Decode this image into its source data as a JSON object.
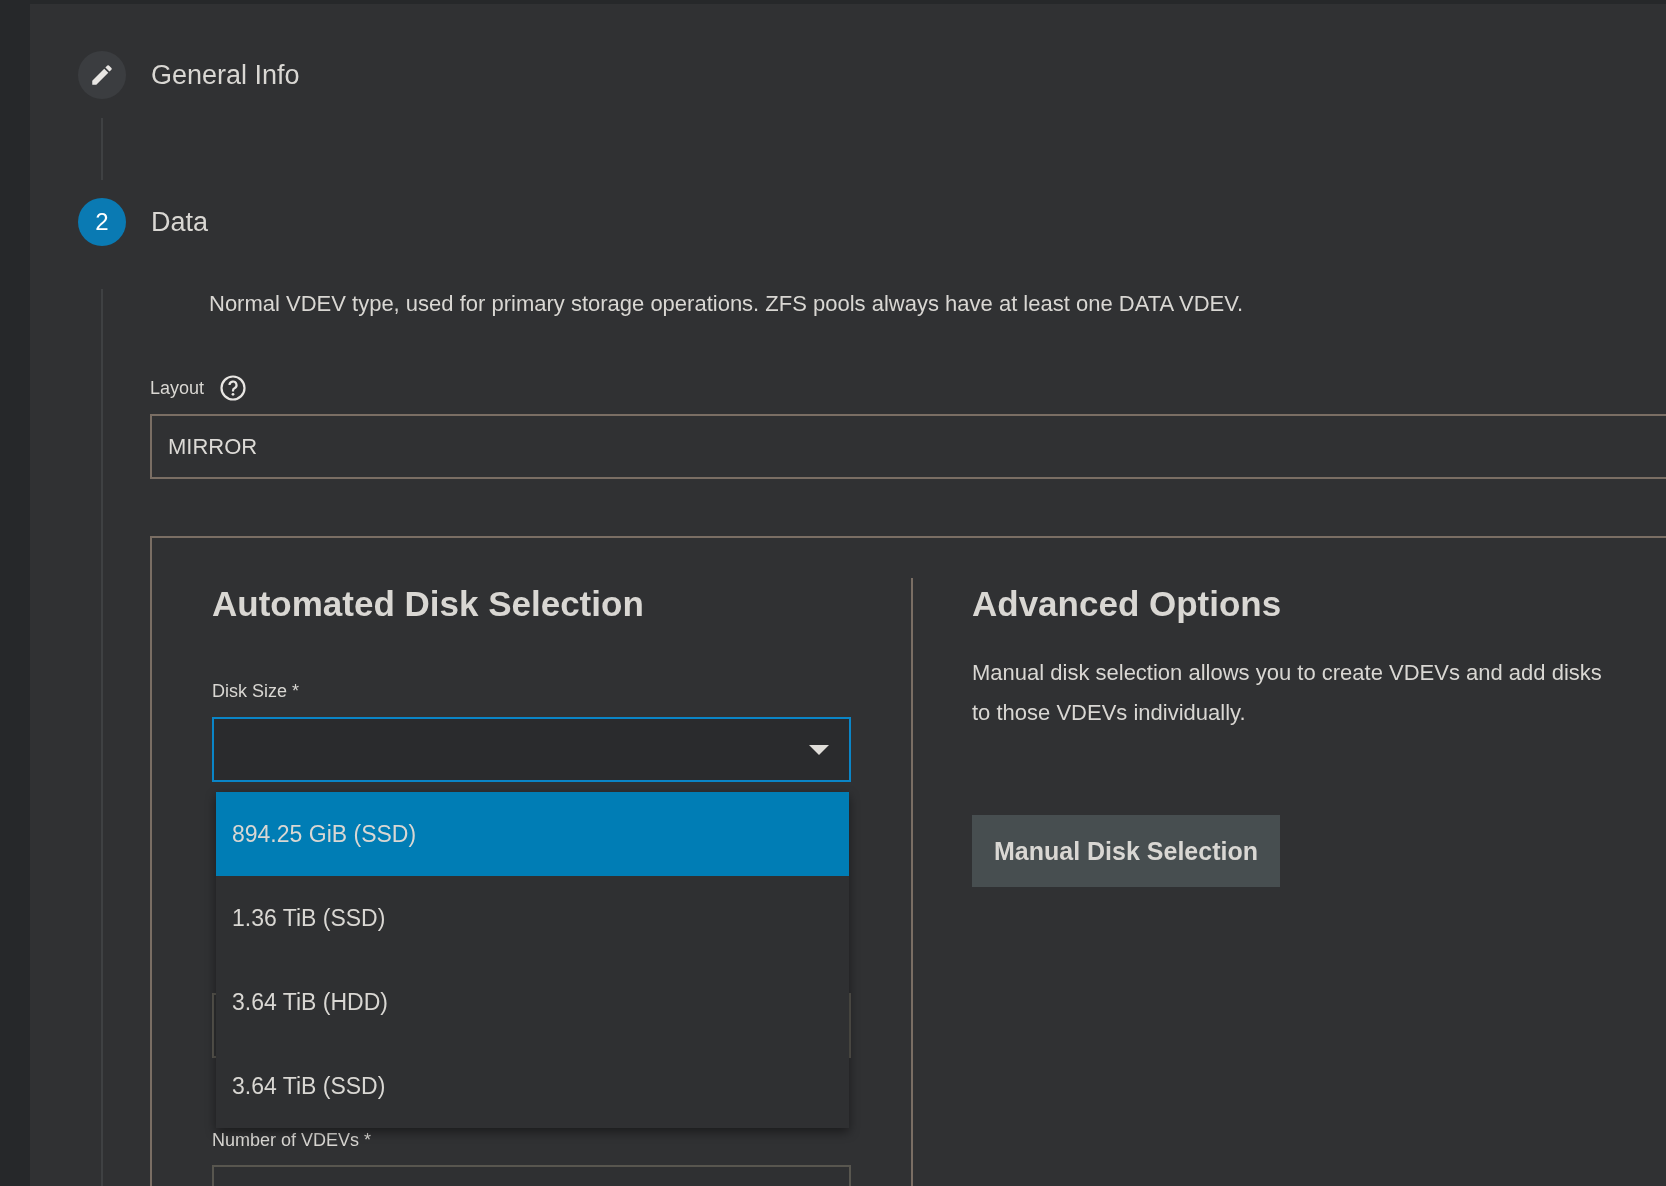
{
  "steps": [
    {
      "kind": "edit",
      "label": "General Info",
      "active": false
    },
    {
      "kind": "number",
      "number": "2",
      "label": "Data",
      "active": true
    }
  ],
  "data_step": {
    "description": "Normal VDEV type, used for primary storage operations. ZFS pools always have at least one DATA VDEV.",
    "layout": {
      "label": "Layout",
      "value": "MIRROR"
    },
    "automated": {
      "title": "Automated Disk Selection",
      "disk_size": {
        "label": "Disk Size *",
        "focused": true,
        "expanded": true,
        "options": [
          {
            "label": "894.25 GiB (SSD)",
            "selected": true
          },
          {
            "label": "1.36 TiB (SSD)",
            "selected": false
          },
          {
            "label": "3.64 TiB (HDD)",
            "selected": false
          },
          {
            "label": "3.64 TiB (SSD)",
            "selected": false
          }
        ]
      },
      "vdevs": {
        "label": "Number of VDEVs *"
      }
    },
    "advanced": {
      "title": "Advanced Options",
      "description": "Manual disk selection allows you to create VDEVs and add disks to those VDEVs individually.",
      "button": "Manual Disk Selection"
    }
  }
}
